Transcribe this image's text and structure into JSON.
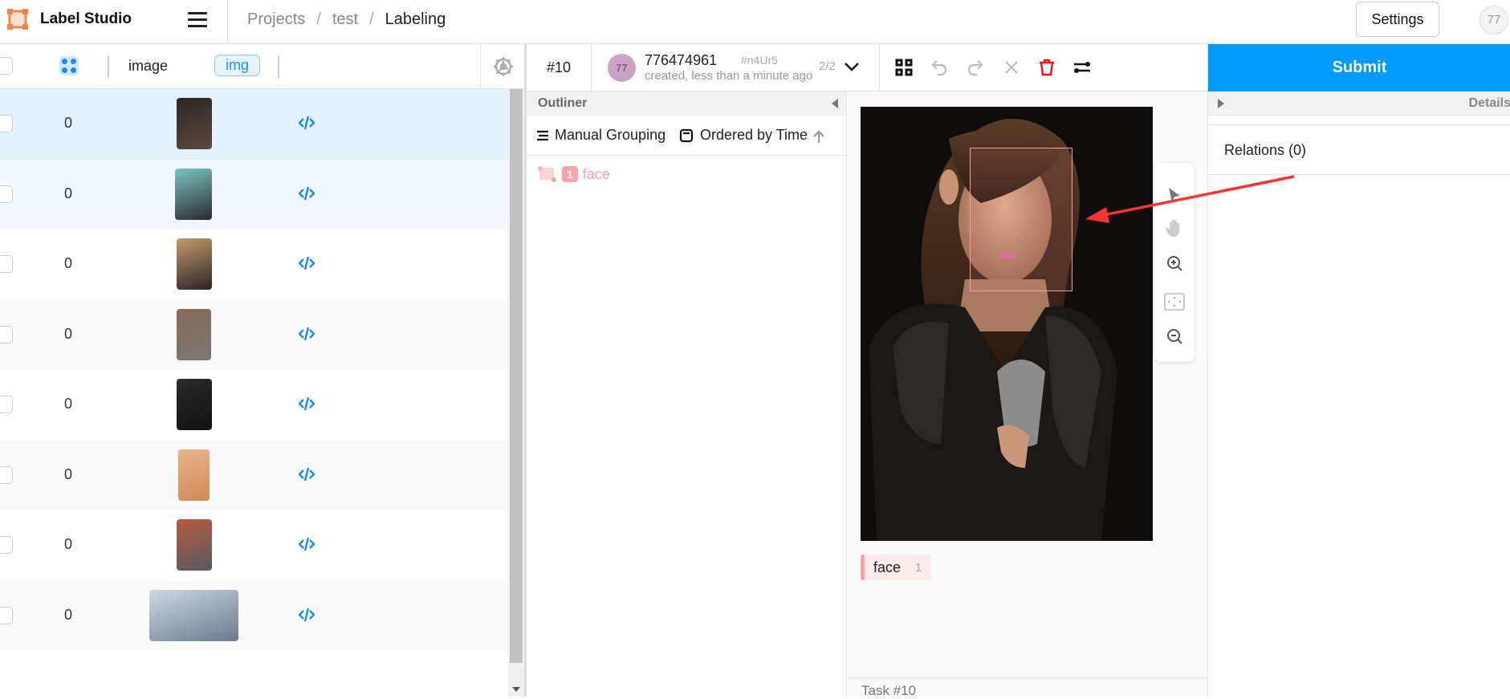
{
  "app": {
    "title": "Label Studio",
    "accent": "#0099ff",
    "logo_color": "#e8884a"
  },
  "breadcrumb": [
    {
      "label": "Projects"
    },
    {
      "label": "test"
    },
    {
      "label": "Labeling"
    }
  ],
  "breadcrumb_sep": "/",
  "header": {
    "settings_label": "Settings",
    "user_initials": "77"
  },
  "table": {
    "columns": [
      {
        "label": "image"
      },
      {
        "label": "img"
      }
    ],
    "rows": [
      {
        "annotations": "0",
        "selected": true
      },
      {
        "annotations": "0"
      },
      {
        "annotations": "0"
      },
      {
        "annotations": "0"
      },
      {
        "annotations": "0"
      },
      {
        "annotations": "0"
      },
      {
        "annotations": "0"
      },
      {
        "annotations": "0"
      }
    ]
  },
  "annotation": {
    "task_id": "#10",
    "annotator_initials": "77",
    "annotation_id": "776474961",
    "hash": "#n4Ur5",
    "meta": "created, less than a minute ago",
    "count": "2/2"
  },
  "outliner": {
    "title": "Outliner",
    "grouping_label": "Manual Grouping",
    "order_label": "Ordered by Time",
    "regions": [
      {
        "index": "1",
        "label": "face",
        "color": "#f9a5a5"
      }
    ]
  },
  "labels": [
    {
      "name": "face",
      "count": "1",
      "color": "#f9a5a5"
    }
  ],
  "footer": {
    "task_label": "Task #10"
  },
  "right_panel": {
    "submit_label": "Submit",
    "details_label": "Details",
    "relations_label": "Relations (0)"
  }
}
